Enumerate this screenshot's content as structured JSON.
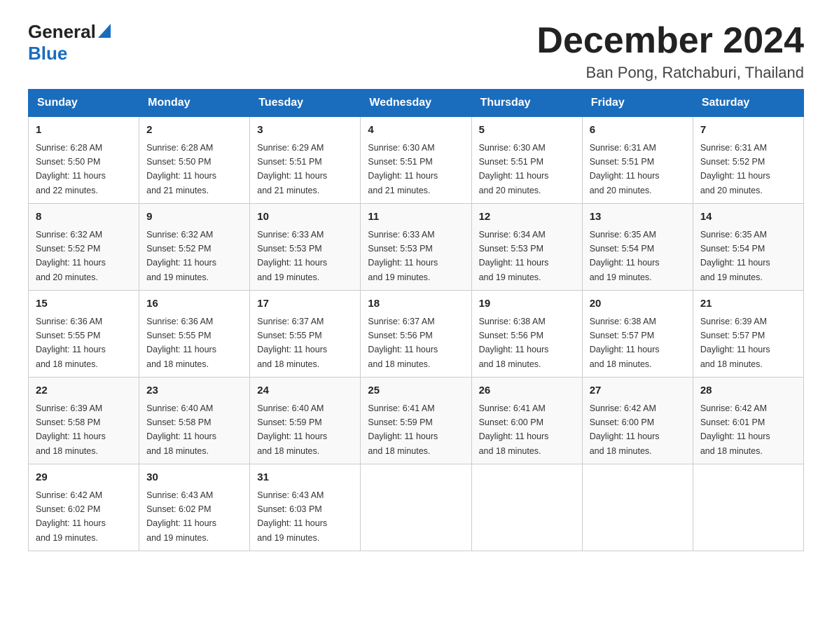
{
  "logo": {
    "general": "General",
    "blue": "Blue"
  },
  "header": {
    "month_year": "December 2024",
    "location": "Ban Pong, Ratchaburi, Thailand"
  },
  "weekdays": [
    "Sunday",
    "Monday",
    "Tuesday",
    "Wednesday",
    "Thursday",
    "Friday",
    "Saturday"
  ],
  "weeks": [
    [
      {
        "day": "1",
        "sunrise": "6:28 AM",
        "sunset": "5:50 PM",
        "daylight": "11 hours and 22 minutes."
      },
      {
        "day": "2",
        "sunrise": "6:28 AM",
        "sunset": "5:50 PM",
        "daylight": "11 hours and 21 minutes."
      },
      {
        "day": "3",
        "sunrise": "6:29 AM",
        "sunset": "5:51 PM",
        "daylight": "11 hours and 21 minutes."
      },
      {
        "day": "4",
        "sunrise": "6:30 AM",
        "sunset": "5:51 PM",
        "daylight": "11 hours and 21 minutes."
      },
      {
        "day": "5",
        "sunrise": "6:30 AM",
        "sunset": "5:51 PM",
        "daylight": "11 hours and 20 minutes."
      },
      {
        "day": "6",
        "sunrise": "6:31 AM",
        "sunset": "5:51 PM",
        "daylight": "11 hours and 20 minutes."
      },
      {
        "day": "7",
        "sunrise": "6:31 AM",
        "sunset": "5:52 PM",
        "daylight": "11 hours and 20 minutes."
      }
    ],
    [
      {
        "day": "8",
        "sunrise": "6:32 AM",
        "sunset": "5:52 PM",
        "daylight": "11 hours and 20 minutes."
      },
      {
        "day": "9",
        "sunrise": "6:32 AM",
        "sunset": "5:52 PM",
        "daylight": "11 hours and 19 minutes."
      },
      {
        "day": "10",
        "sunrise": "6:33 AM",
        "sunset": "5:53 PM",
        "daylight": "11 hours and 19 minutes."
      },
      {
        "day": "11",
        "sunrise": "6:33 AM",
        "sunset": "5:53 PM",
        "daylight": "11 hours and 19 minutes."
      },
      {
        "day": "12",
        "sunrise": "6:34 AM",
        "sunset": "5:53 PM",
        "daylight": "11 hours and 19 minutes."
      },
      {
        "day": "13",
        "sunrise": "6:35 AM",
        "sunset": "5:54 PM",
        "daylight": "11 hours and 19 minutes."
      },
      {
        "day": "14",
        "sunrise": "6:35 AM",
        "sunset": "5:54 PM",
        "daylight": "11 hours and 19 minutes."
      }
    ],
    [
      {
        "day": "15",
        "sunrise": "6:36 AM",
        "sunset": "5:55 PM",
        "daylight": "11 hours and 18 minutes."
      },
      {
        "day": "16",
        "sunrise": "6:36 AM",
        "sunset": "5:55 PM",
        "daylight": "11 hours and 18 minutes."
      },
      {
        "day": "17",
        "sunrise": "6:37 AM",
        "sunset": "5:55 PM",
        "daylight": "11 hours and 18 minutes."
      },
      {
        "day": "18",
        "sunrise": "6:37 AM",
        "sunset": "5:56 PM",
        "daylight": "11 hours and 18 minutes."
      },
      {
        "day": "19",
        "sunrise": "6:38 AM",
        "sunset": "5:56 PM",
        "daylight": "11 hours and 18 minutes."
      },
      {
        "day": "20",
        "sunrise": "6:38 AM",
        "sunset": "5:57 PM",
        "daylight": "11 hours and 18 minutes."
      },
      {
        "day": "21",
        "sunrise": "6:39 AM",
        "sunset": "5:57 PM",
        "daylight": "11 hours and 18 minutes."
      }
    ],
    [
      {
        "day": "22",
        "sunrise": "6:39 AM",
        "sunset": "5:58 PM",
        "daylight": "11 hours and 18 minutes."
      },
      {
        "day": "23",
        "sunrise": "6:40 AM",
        "sunset": "5:58 PM",
        "daylight": "11 hours and 18 minutes."
      },
      {
        "day": "24",
        "sunrise": "6:40 AM",
        "sunset": "5:59 PM",
        "daylight": "11 hours and 18 minutes."
      },
      {
        "day": "25",
        "sunrise": "6:41 AM",
        "sunset": "5:59 PM",
        "daylight": "11 hours and 18 minutes."
      },
      {
        "day": "26",
        "sunrise": "6:41 AM",
        "sunset": "6:00 PM",
        "daylight": "11 hours and 18 minutes."
      },
      {
        "day": "27",
        "sunrise": "6:42 AM",
        "sunset": "6:00 PM",
        "daylight": "11 hours and 18 minutes."
      },
      {
        "day": "28",
        "sunrise": "6:42 AM",
        "sunset": "6:01 PM",
        "daylight": "11 hours and 18 minutes."
      }
    ],
    [
      {
        "day": "29",
        "sunrise": "6:42 AM",
        "sunset": "6:02 PM",
        "daylight": "11 hours and 19 minutes."
      },
      {
        "day": "30",
        "sunrise": "6:43 AM",
        "sunset": "6:02 PM",
        "daylight": "11 hours and 19 minutes."
      },
      {
        "day": "31",
        "sunrise": "6:43 AM",
        "sunset": "6:03 PM",
        "daylight": "11 hours and 19 minutes."
      },
      null,
      null,
      null,
      null
    ]
  ],
  "labels": {
    "sunrise": "Sunrise:",
    "sunset": "Sunset:",
    "daylight": "Daylight:"
  }
}
